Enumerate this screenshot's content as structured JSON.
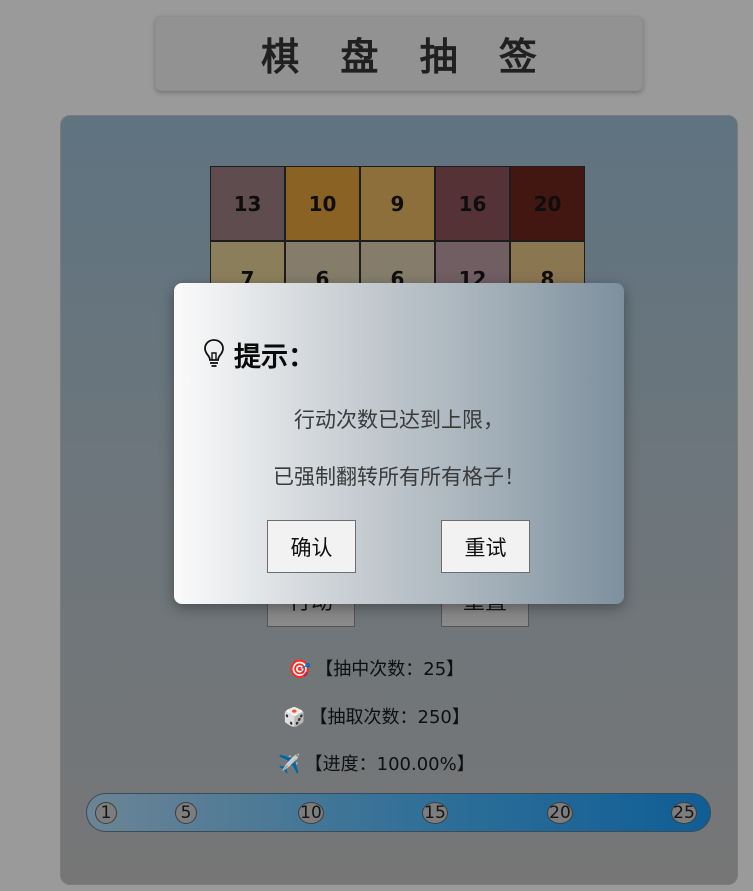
{
  "title": "棋 盘 抽 签",
  "grid": {
    "rows": [
      [
        {
          "value": "13",
          "color": "#5f4c4f"
        },
        {
          "value": "10",
          "color": "#8a6224"
        },
        {
          "value": "9",
          "color": "#8d6f3c"
        },
        {
          "value": "16",
          "color": "#553236"
        },
        {
          "value": "20",
          "color": "#431711"
        }
      ],
      [
        {
          "value": "7",
          "color": "#8b7f5b"
        },
        {
          "value": "6",
          "color": "#857d6a"
        },
        {
          "value": "6",
          "color": "#857d6a"
        },
        {
          "value": "12",
          "color": "#705e63"
        },
        {
          "value": "8",
          "color": "#8a7651"
        }
      ]
    ]
  },
  "buttons": {
    "act": "行动",
    "reset": "重置"
  },
  "stats": {
    "hits": {
      "icon": "🎯",
      "text": "【抽中次数：25】"
    },
    "draws": {
      "icon": "🎲",
      "text": "【抽取次数：250】"
    },
    "progress": {
      "icon": "✈️",
      "text": "【进度：100.00%】"
    }
  },
  "progress_bar": {
    "value_percent": 100,
    "ticks": [
      "1",
      "5",
      "10",
      "15",
      "20",
      "25"
    ]
  },
  "modal": {
    "icon": "lightbulb-icon",
    "title": "提示：",
    "line1": "行动次数已达到上限，",
    "line2": "已强制翻转所有所有格子！",
    "confirm_label": "确认",
    "retry_label": "重试"
  }
}
